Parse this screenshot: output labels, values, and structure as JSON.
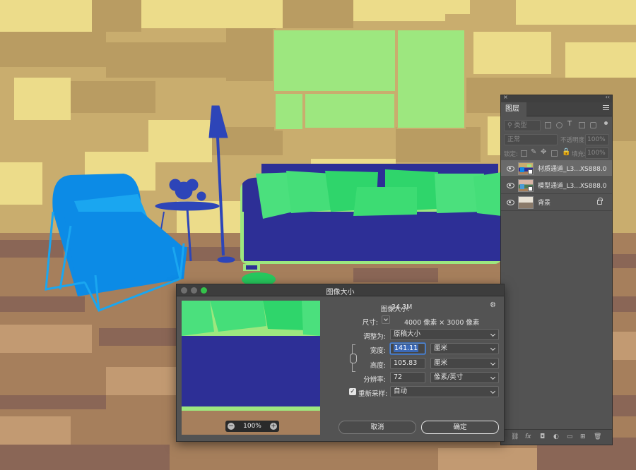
{
  "layers_panel": {
    "close": "×",
    "collapse": "‹‹",
    "tab": "图层",
    "kind_filter": "类型",
    "blend_mode": "正常",
    "opacity_label": "不透明度:",
    "opacity_value": "100%",
    "lock_label": "锁定:",
    "fill_label": "填充:",
    "fill_value": "100%",
    "layers": [
      {
        "name": "材质通道_L3...XS888.0",
        "selected": true
      },
      {
        "name": "模型通道_L3...XS888.0",
        "selected": false
      },
      {
        "name": "背景",
        "selected": false,
        "locked": true
      }
    ],
    "bottom_icons": [
      "link-icon",
      "fx-icon",
      "mask-icon",
      "adjustment-icon",
      "folder-icon",
      "new-layer-icon",
      "trash-icon"
    ],
    "fx": "fx"
  },
  "dialog": {
    "title": "图像大小",
    "image_size_label": "图像大小:",
    "image_size_value": "34.3M",
    "dimensions_label": "尺寸:",
    "dimensions_value": "4000 像素  ×  3000 像素",
    "fit_label": "调整为:",
    "fit_value": "原稿大小",
    "width_label": "宽度:",
    "width_value": "141.11",
    "width_unit": "厘米",
    "height_label": "高度:",
    "height_value": "105.83",
    "height_unit": "厘米",
    "resolution_label": "分辨率:",
    "resolution_value": "72",
    "resolution_unit": "像素/英寸",
    "resample_label": "重新采样:",
    "resample_value": "自动",
    "zoom_value": "100%",
    "cancel": "取消",
    "ok": "确定"
  },
  "colors": {
    "wall_light": "#ecdc8a",
    "wall_mid": "#c9ad6e",
    "floor": "#a67f5c",
    "sofa_blue": "#2d2f96",
    "pillow_green": "#3ddc73",
    "frame_green": "#9de77f",
    "chair_blue": "#0c8be6",
    "panel_bg": "#535353",
    "accent_blue": "#3b69b7"
  }
}
